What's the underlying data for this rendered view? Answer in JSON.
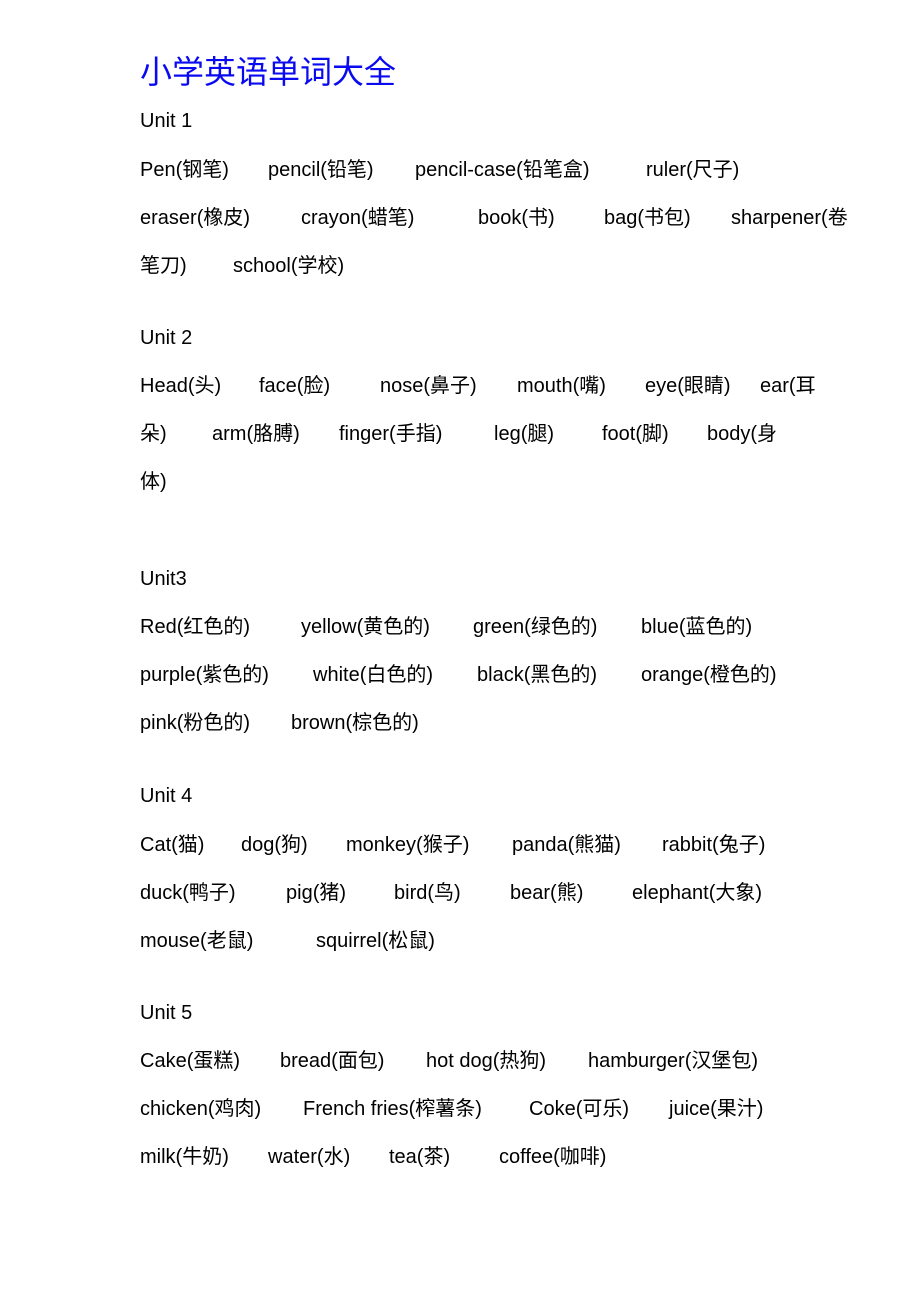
{
  "title": "小学英语单词大全",
  "units": [
    {
      "label": "Unit 1",
      "lines": [
        [
          "Pen(钢笔)",
          "pencil(铅笔)",
          "pencil-case(铅笔盒)",
          "ruler(尺子)"
        ],
        [
          "eraser(橡皮)",
          "crayon(蜡笔)",
          "book(书)",
          "bag(书包)",
          "sharpener(卷"
        ],
        [
          "笔刀)",
          "school(学校)"
        ]
      ]
    },
    {
      "label": "Unit 2",
      "lines": [
        [
          "Head(头)",
          "face(脸)",
          "nose(鼻子)",
          "mouth(嘴)",
          "eye(眼睛)",
          "ear(耳"
        ],
        [
          "朵)",
          "arm(胳膊)",
          "finger(手指)",
          "leg(腿)",
          "foot(脚)",
          "body(身"
        ],
        [
          "体)"
        ]
      ]
    },
    {
      "label": "Unit3",
      "lines": [
        [
          "Red(红色的)",
          "yellow(黄色的)",
          "green(绿色的)",
          "blue(蓝色的)"
        ],
        [
          "purple(紫色的)",
          "white(白色的)",
          "black(黑色的)",
          "orange(橙色的)"
        ],
        [
          "pink(粉色的)",
          "brown(棕色的)"
        ]
      ]
    },
    {
      "label": "Unit 4",
      "lines": [
        [
          "Cat(猫)",
          "dog(狗)",
          "monkey(猴子)",
          "panda(熊猫)",
          "rabbit(兔子)"
        ],
        [
          "duck(鸭子)",
          "pig(猪)",
          "bird(鸟)",
          "bear(熊)",
          "elephant(大象)"
        ],
        [
          "mouse(老鼠)",
          "squirrel(松鼠)"
        ]
      ]
    },
    {
      "label": "Unit 5",
      "lines": [
        [
          "Cake(蛋糕)",
          "bread(面包)",
          "hot dog(热狗)",
          "hamburger(汉堡包)"
        ],
        [
          "chicken(鸡肉)",
          "French fries(榨薯条)",
          "Coke(可乐)",
          "juice(果汁)"
        ],
        [
          "milk(牛奶)",
          "water(水)",
          "tea(茶)",
          "coffee(咖啡)"
        ]
      ]
    }
  ]
}
